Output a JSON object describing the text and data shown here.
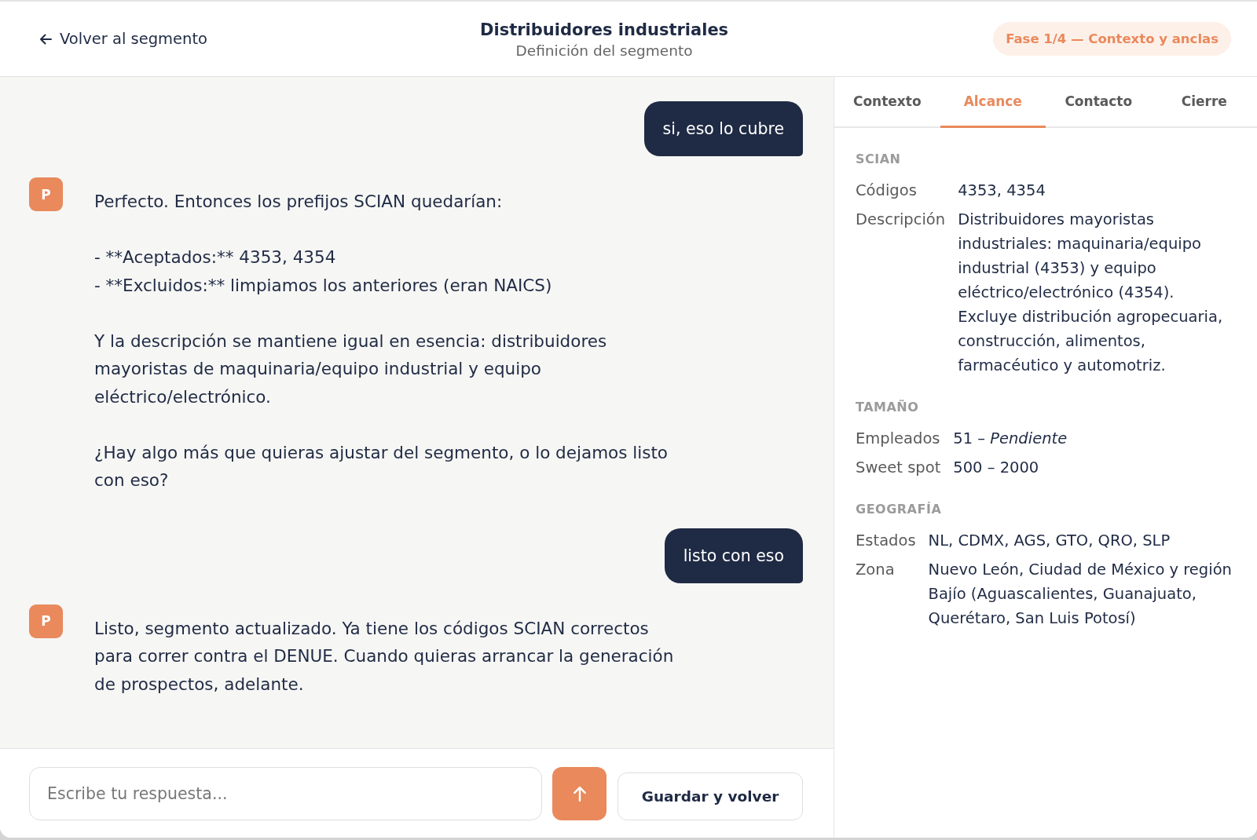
{
  "header": {
    "back_link": "Volver al segmento",
    "title": "Distribuidores industriales",
    "subtitle": "Definición del segmento",
    "phase_badge": "Fase 1/4 — Contexto y anclas"
  },
  "messages": [
    {
      "kind": "user",
      "text": "si, eso lo cubre"
    },
    {
      "kind": "assistant",
      "avatar": "P",
      "text": "Perfecto. Entonces los prefijos SCIAN quedarían:\n\n- **Aceptados:** 4353, 4354\n- **Excluidos:** limpiamos los anteriores (eran NAICS)\n\nY la descripción se mantiene igual en esencia: distribuidores mayoristas de maquinaria/equipo industrial y equipo eléctrico/electrónico.\n\n¿Hay algo más que quieras ajustar del segmento, o lo dejamos listo con eso?"
    },
    {
      "kind": "user",
      "text": "listo con eso"
    },
    {
      "kind": "assistant",
      "avatar": "P",
      "text": "Listo, segmento actualizado. Ya tiene los códigos SCIAN correctos para correr contra el DENUE. Cuando quieras arrancar la generación de prospectos, adelante."
    }
  ],
  "composer": {
    "placeholder": "Escribe tu respuesta...",
    "save_button": "Guardar y volver"
  },
  "tabs": [
    {
      "label": "Contexto",
      "selected": false
    },
    {
      "label": "Alcance",
      "selected": true
    },
    {
      "label": "Contacto",
      "selected": false
    },
    {
      "label": "Cierre",
      "selected": false
    }
  ],
  "sections": [
    {
      "heading": "SCIAN",
      "fields": [
        {
          "label": "Códigos",
          "value": "4353, 4354"
        },
        {
          "label": "Descripción",
          "value": "Distribuidores mayoristas industriales: maquinaria/equipo industrial (4353) y equipo eléctrico/electrónico (4354). Excluye distribución agropecuaria, construcción, alimentos, farmacéutico y automotriz."
        }
      ]
    },
    {
      "heading": "TAMAÑO",
      "fields": [
        {
          "label": "Empleados",
          "value": "51 – *Pendiente*"
        },
        {
          "label": "Sweet spot",
          "value": "500 – 2000"
        }
      ]
    },
    {
      "heading": "GEOGRAFÍA",
      "fields": [
        {
          "label": "Estados",
          "value": "NL, CDMX, AGS, GTO, QRO, SLP"
        },
        {
          "label": "Zona",
          "value": "Nuevo León, Ciudad de México y región Bajío (Aguascalientes, Guanajuato, Querétaro, San Luis Potosí)"
        }
      ]
    }
  ]
}
